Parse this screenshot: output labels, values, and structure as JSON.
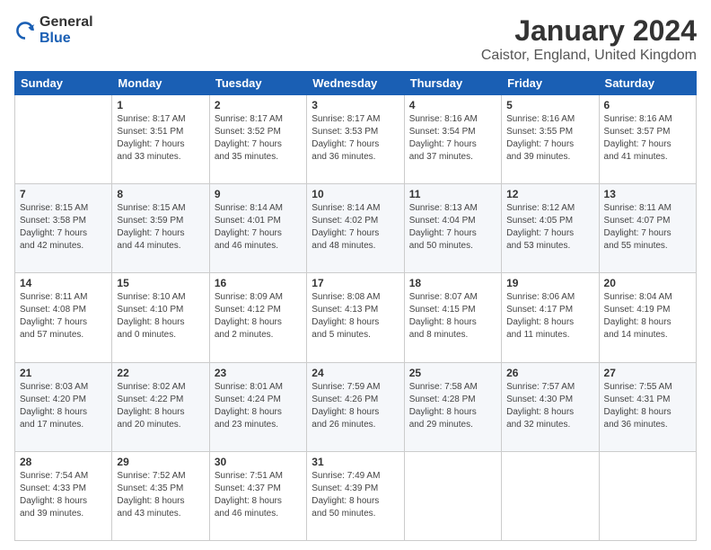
{
  "logo": {
    "general": "General",
    "blue": "Blue"
  },
  "header": {
    "title": "January 2024",
    "subtitle": "Caistor, England, United Kingdom"
  },
  "days_of_week": [
    "Sunday",
    "Monday",
    "Tuesday",
    "Wednesday",
    "Thursday",
    "Friday",
    "Saturday"
  ],
  "weeks": [
    [
      {
        "num": "",
        "info": ""
      },
      {
        "num": "1",
        "info": "Sunrise: 8:17 AM\nSunset: 3:51 PM\nDaylight: 7 hours\nand 33 minutes."
      },
      {
        "num": "2",
        "info": "Sunrise: 8:17 AM\nSunset: 3:52 PM\nDaylight: 7 hours\nand 35 minutes."
      },
      {
        "num": "3",
        "info": "Sunrise: 8:17 AM\nSunset: 3:53 PM\nDaylight: 7 hours\nand 36 minutes."
      },
      {
        "num": "4",
        "info": "Sunrise: 8:16 AM\nSunset: 3:54 PM\nDaylight: 7 hours\nand 37 minutes."
      },
      {
        "num": "5",
        "info": "Sunrise: 8:16 AM\nSunset: 3:55 PM\nDaylight: 7 hours\nand 39 minutes."
      },
      {
        "num": "6",
        "info": "Sunrise: 8:16 AM\nSunset: 3:57 PM\nDaylight: 7 hours\nand 41 minutes."
      }
    ],
    [
      {
        "num": "7",
        "info": "Sunrise: 8:15 AM\nSunset: 3:58 PM\nDaylight: 7 hours\nand 42 minutes."
      },
      {
        "num": "8",
        "info": "Sunrise: 8:15 AM\nSunset: 3:59 PM\nDaylight: 7 hours\nand 44 minutes."
      },
      {
        "num": "9",
        "info": "Sunrise: 8:14 AM\nSunset: 4:01 PM\nDaylight: 7 hours\nand 46 minutes."
      },
      {
        "num": "10",
        "info": "Sunrise: 8:14 AM\nSunset: 4:02 PM\nDaylight: 7 hours\nand 48 minutes."
      },
      {
        "num": "11",
        "info": "Sunrise: 8:13 AM\nSunset: 4:04 PM\nDaylight: 7 hours\nand 50 minutes."
      },
      {
        "num": "12",
        "info": "Sunrise: 8:12 AM\nSunset: 4:05 PM\nDaylight: 7 hours\nand 53 minutes."
      },
      {
        "num": "13",
        "info": "Sunrise: 8:11 AM\nSunset: 4:07 PM\nDaylight: 7 hours\nand 55 minutes."
      }
    ],
    [
      {
        "num": "14",
        "info": "Sunrise: 8:11 AM\nSunset: 4:08 PM\nDaylight: 7 hours\nand 57 minutes."
      },
      {
        "num": "15",
        "info": "Sunrise: 8:10 AM\nSunset: 4:10 PM\nDaylight: 8 hours\nand 0 minutes."
      },
      {
        "num": "16",
        "info": "Sunrise: 8:09 AM\nSunset: 4:12 PM\nDaylight: 8 hours\nand 2 minutes."
      },
      {
        "num": "17",
        "info": "Sunrise: 8:08 AM\nSunset: 4:13 PM\nDaylight: 8 hours\nand 5 minutes."
      },
      {
        "num": "18",
        "info": "Sunrise: 8:07 AM\nSunset: 4:15 PM\nDaylight: 8 hours\nand 8 minutes."
      },
      {
        "num": "19",
        "info": "Sunrise: 8:06 AM\nSunset: 4:17 PM\nDaylight: 8 hours\nand 11 minutes."
      },
      {
        "num": "20",
        "info": "Sunrise: 8:04 AM\nSunset: 4:19 PM\nDaylight: 8 hours\nand 14 minutes."
      }
    ],
    [
      {
        "num": "21",
        "info": "Sunrise: 8:03 AM\nSunset: 4:20 PM\nDaylight: 8 hours\nand 17 minutes."
      },
      {
        "num": "22",
        "info": "Sunrise: 8:02 AM\nSunset: 4:22 PM\nDaylight: 8 hours\nand 20 minutes."
      },
      {
        "num": "23",
        "info": "Sunrise: 8:01 AM\nSunset: 4:24 PM\nDaylight: 8 hours\nand 23 minutes."
      },
      {
        "num": "24",
        "info": "Sunrise: 7:59 AM\nSunset: 4:26 PM\nDaylight: 8 hours\nand 26 minutes."
      },
      {
        "num": "25",
        "info": "Sunrise: 7:58 AM\nSunset: 4:28 PM\nDaylight: 8 hours\nand 29 minutes."
      },
      {
        "num": "26",
        "info": "Sunrise: 7:57 AM\nSunset: 4:30 PM\nDaylight: 8 hours\nand 32 minutes."
      },
      {
        "num": "27",
        "info": "Sunrise: 7:55 AM\nSunset: 4:31 PM\nDaylight: 8 hours\nand 36 minutes."
      }
    ],
    [
      {
        "num": "28",
        "info": "Sunrise: 7:54 AM\nSunset: 4:33 PM\nDaylight: 8 hours\nand 39 minutes."
      },
      {
        "num": "29",
        "info": "Sunrise: 7:52 AM\nSunset: 4:35 PM\nDaylight: 8 hours\nand 43 minutes."
      },
      {
        "num": "30",
        "info": "Sunrise: 7:51 AM\nSunset: 4:37 PM\nDaylight: 8 hours\nand 46 minutes."
      },
      {
        "num": "31",
        "info": "Sunrise: 7:49 AM\nSunset: 4:39 PM\nDaylight: 8 hours\nand 50 minutes."
      },
      {
        "num": "",
        "info": ""
      },
      {
        "num": "",
        "info": ""
      },
      {
        "num": "",
        "info": ""
      }
    ]
  ]
}
